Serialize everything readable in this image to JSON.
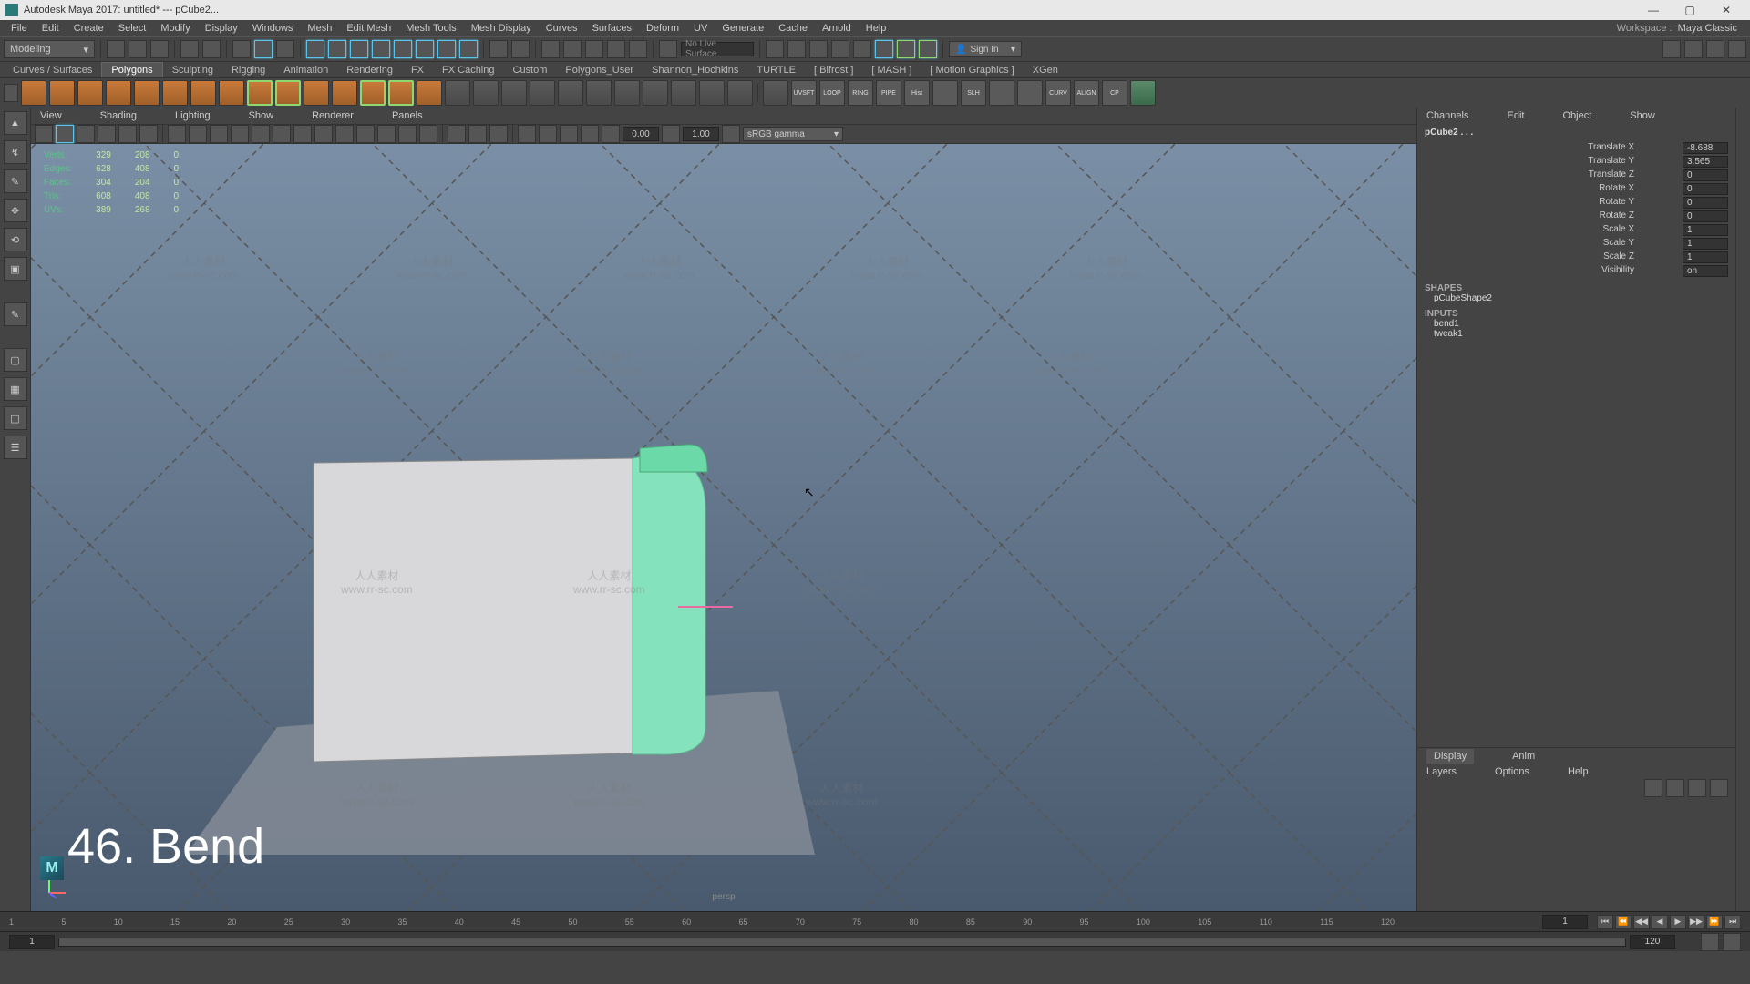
{
  "title": "Autodesk Maya 2017: untitled*  ---  pCube2...",
  "menubar": [
    "File",
    "Edit",
    "Create",
    "Select",
    "Modify",
    "Display",
    "Windows",
    "Mesh",
    "Edit Mesh",
    "Mesh Tools",
    "Mesh Display",
    "Curves",
    "Surfaces",
    "Deform",
    "UV",
    "Generate",
    "Cache",
    "Arnold",
    "Help"
  ],
  "workspace_label": "Workspace :",
  "workspace_value": "Maya Classic",
  "mode": "Modeling",
  "live_surface": "No Live Surface",
  "signin": "Sign In",
  "shelf_tabs": [
    "Curves / Surfaces",
    "Polygons",
    "Sculpting",
    "Rigging",
    "Animation",
    "Rendering",
    "FX",
    "FX Caching",
    "Custom",
    "Polygons_User",
    "Shannon_Hochkins",
    "TURTLE",
    "[  Bifrost  ]",
    "[  MASH  ]",
    "[  Motion Graphics  ]",
    "XGen"
  ],
  "shelf_active": 1,
  "shelf_lbls": [
    "UVSFT",
    "LOOP",
    "RING",
    "PIPE",
    "Hist",
    "",
    "SLH",
    "",
    "",
    "CURV",
    "ALIGN",
    "CP"
  ],
  "panel_menu": [
    "View",
    "Shading",
    "Lighting",
    "Show",
    "Renderer",
    "Panels"
  ],
  "num1": "0.00",
  "num2": "1.00",
  "gamma": "sRGB gamma",
  "hud": {
    "rows": [
      {
        "label": "Verts:",
        "a": "329",
        "b": "208",
        "c": "0"
      },
      {
        "label": "Edges:",
        "a": "628",
        "b": "408",
        "c": "0"
      },
      {
        "label": "Faces:",
        "a": "304",
        "b": "204",
        "c": "0"
      },
      {
        "label": "Tris:",
        "a": "608",
        "b": "408",
        "c": "0"
      },
      {
        "label": "UVs:",
        "a": "389",
        "b": "268",
        "c": "0"
      }
    ]
  },
  "lesson": "46. Bend",
  "persp": "persp",
  "right_tabs": [
    "Channels",
    "Edit",
    "Object",
    "Show"
  ],
  "obj": "pCube2 . . .",
  "attrs": [
    {
      "a": "Translate X",
      "v": "-8.688"
    },
    {
      "a": "Translate Y",
      "v": "3.565"
    },
    {
      "a": "Translate Z",
      "v": "0"
    },
    {
      "a": "Rotate X",
      "v": "0"
    },
    {
      "a": "Rotate Y",
      "v": "0"
    },
    {
      "a": "Rotate Z",
      "v": "0"
    },
    {
      "a": "Scale X",
      "v": "1"
    },
    {
      "a": "Scale Y",
      "v": "1"
    },
    {
      "a": "Scale Z",
      "v": "1"
    },
    {
      "a": "Visibility",
      "v": "on"
    }
  ],
  "sections": {
    "shapes": "SHAPES",
    "shape_node": "pCubeShape2",
    "inputs": "INPUTS",
    "input1": "bend1",
    "input2": "tweak1"
  },
  "layer_tabs": [
    "Display",
    "Anim"
  ],
  "layer_menu": [
    "Layers",
    "Options",
    "Help"
  ],
  "timeline_ticks": [
    "1",
    "5",
    "10",
    "15",
    "20",
    "25",
    "30",
    "35",
    "40",
    "45",
    "50",
    "55",
    "60",
    "65",
    "70",
    "75",
    "80",
    "85",
    "90",
    "95",
    "100",
    "105",
    "110",
    "115",
    "120"
  ],
  "range_start": "1",
  "range_end": "120",
  "cur_frame": "1",
  "watermark_cn": "人人素材",
  "watermark_url": "www.rr-sc.com"
}
